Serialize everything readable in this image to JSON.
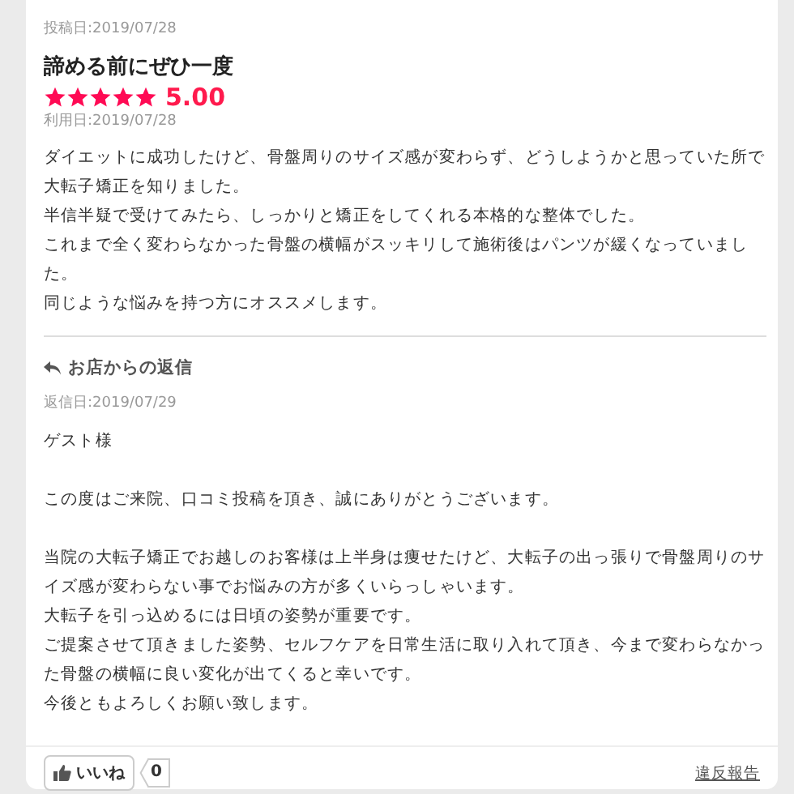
{
  "review": {
    "posted_date": "投稿日:2019/07/28",
    "title": "諦める前にぜひ一度",
    "stars": 5,
    "rating": "5.00",
    "used_date": "利用日:2019/07/28",
    "body": [
      "ダイエットに成功したけど、骨盤周りのサイズ感が変わらず、どうしようかと思っていた所で大転子矯正を知りました。",
      "半信半疑で受けてみたら、しっかりと矯正をしてくれる本格的な整体でした。",
      "これまで全く変わらなかった骨盤の横幅がスッキリして施術後はパンツが緩くなっていました。",
      "同じような悩みを持つ方にオススメします。"
    ]
  },
  "reply": {
    "heading": "お店からの返信",
    "date": "返信日:2019/07/29",
    "paragraphs": [
      [
        "ゲスト様"
      ],
      [
        "この度はご来院、口コミ投稿を頂き、誠にありがとうございます。"
      ],
      [
        "当院の大転子矯正でお越しのお客様は上半身は痩せたけど、大転子の出っ張りで骨盤周りのサイズ感が変わらない事でお悩みの方が多くいらっしゃいます。",
        "大転子を引っ込めるには日頃の姿勢が重要です。",
        "ご提案させて頂きました姿勢、セルフケアを日常生活に取り入れて頂き、今まで変わらなかった骨盤の横幅に良い変化が出てくると幸いです。",
        "今後ともよろしくお願い致します。"
      ]
    ]
  },
  "footer": {
    "like_label": "いいね",
    "like_count": "0",
    "report_link": "違反報告"
  }
}
